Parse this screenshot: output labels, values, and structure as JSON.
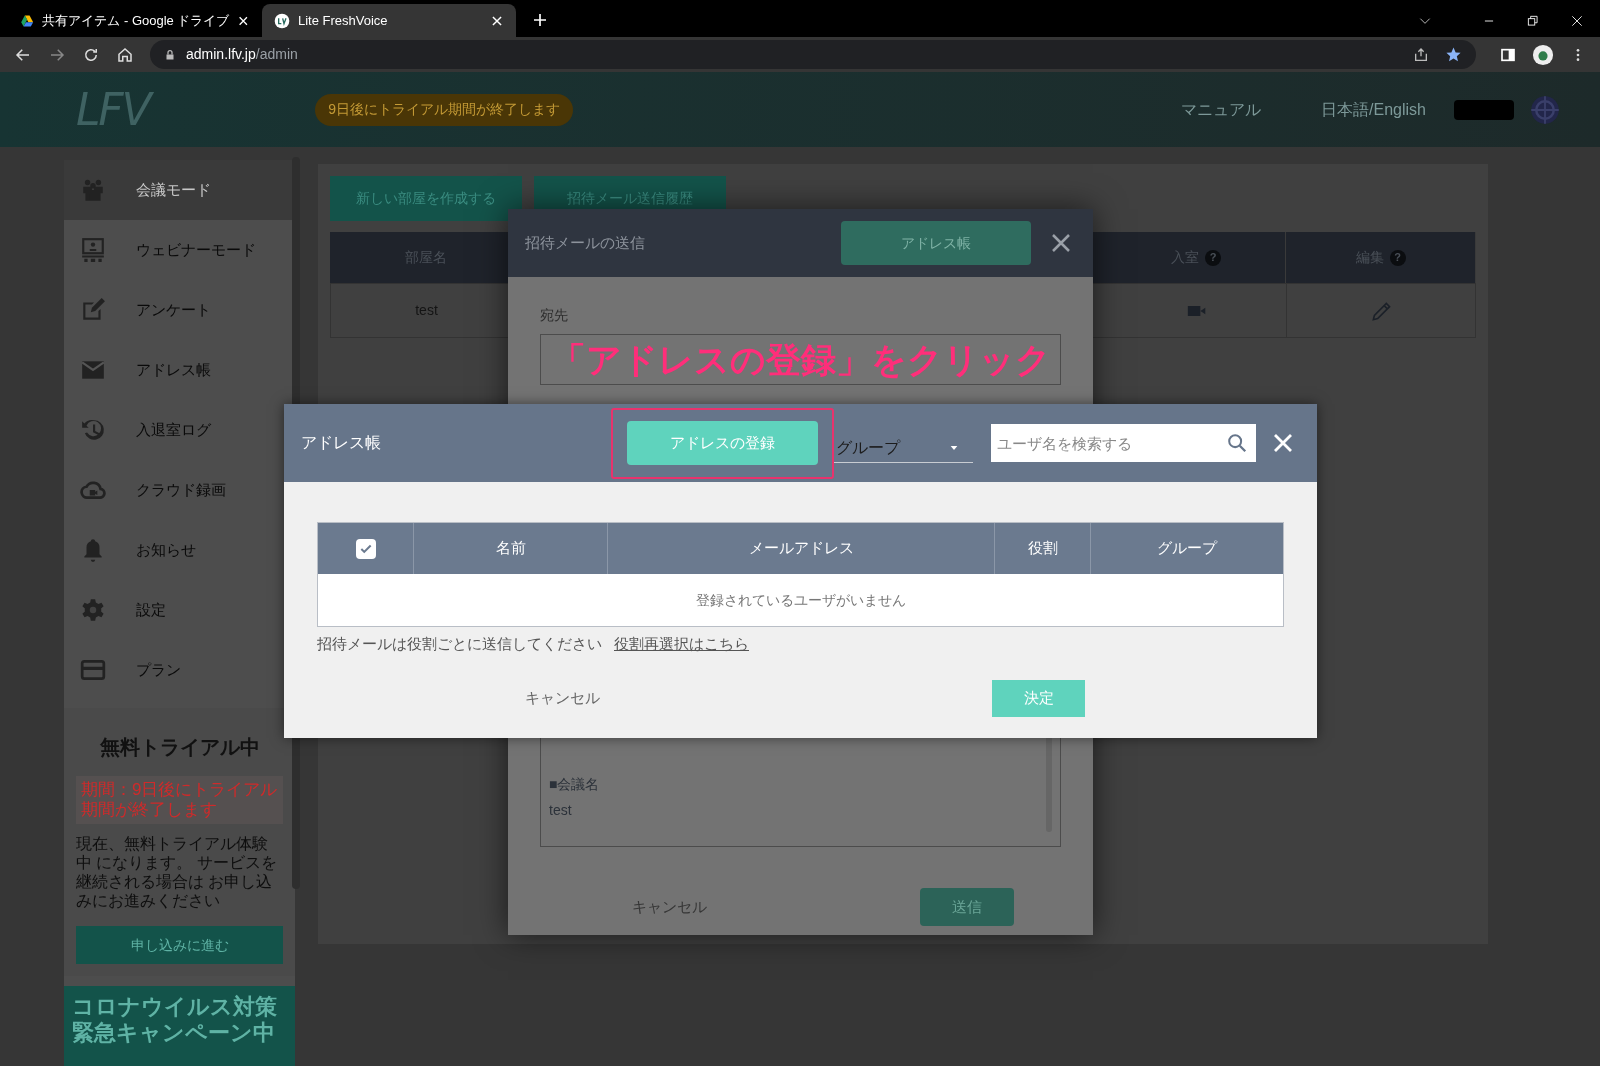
{
  "browser": {
    "tabs": [
      {
        "title": "共有アイテム - Google ドライブ",
        "selected": false
      },
      {
        "title": "Lite FreshVoice",
        "selected": true
      }
    ],
    "url": {
      "host": "admin.lfv.jp",
      "path": "/admin"
    }
  },
  "header": {
    "logo": "LFV",
    "trial_notice": "9日後にトライアル期間が終了します",
    "links": [
      "マニュアル",
      "日本語/English"
    ]
  },
  "sidebar": {
    "items": [
      {
        "label": "会議モード",
        "selected": true
      },
      {
        "label": "ウェビナーモード",
        "selected": false
      },
      {
        "label": "アンケート",
        "selected": false
      },
      {
        "label": "アドレス帳",
        "selected": false
      },
      {
        "label": "入退室ログ",
        "selected": false
      },
      {
        "label": "クラウド録画",
        "selected": false
      },
      {
        "label": "お知らせ",
        "selected": false
      },
      {
        "label": "設定",
        "selected": false
      },
      {
        "label": "プラン",
        "selected": false
      }
    ],
    "trial": {
      "title": "無料トライアル中",
      "period": "期間：9日後にトライアル期間が終了します",
      "description": "現在、無料トライアル体験中 になります。 サービスを継続される場合は お申し込みにお進みください",
      "apply_button": "申し込みに進む",
      "campaign": "コロナウイルス対策緊急キャンペーン中"
    }
  },
  "rooms": {
    "buttons": [
      "新しい部屋を作成する",
      "招待メール送信履歴"
    ],
    "columns": [
      {
        "label": "部屋名"
      },
      {
        "label": "入室",
        "help": "?"
      },
      {
        "label": "編集",
        "help": "?"
      }
    ],
    "rows": [
      {
        "name": "test"
      }
    ]
  },
  "invite_modal": {
    "title": "招待メールの送信",
    "address_book_button": "アドレス帳",
    "to_label": "宛先",
    "body_heading": "■会議名",
    "body_text": "test",
    "cancel": "キャンセル",
    "send": "送信"
  },
  "annotation": "「アドレスの登録」をクリック",
  "address_book": {
    "title": "アドレス帳",
    "register_button": "アドレスの登録",
    "group_select": "グループ",
    "search": {
      "placeholder": "ユーザ名を検索する"
    },
    "select_all": {
      "checked": true
    },
    "columns": [
      "名前",
      "メールアドレス",
      "役割",
      "グループ"
    ],
    "empty_message": "登録されているユーザがいません",
    "note": "招待メールは役割ごとに送信してください",
    "reselect_link": "役割再選択はこちら",
    "cancel": "キャンセル",
    "confirm": "決定"
  }
}
